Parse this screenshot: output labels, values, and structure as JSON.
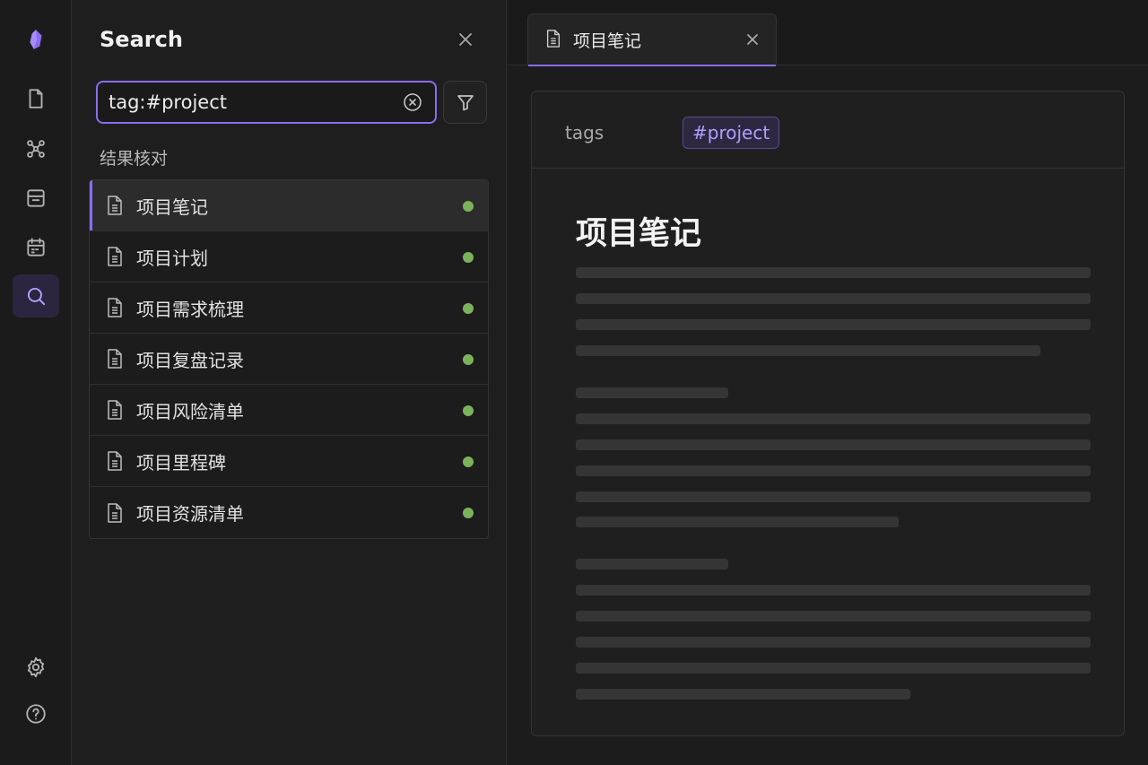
{
  "ribbon": {
    "items": [
      {
        "name": "app-logo-icon"
      },
      {
        "name": "files-icon"
      },
      {
        "name": "graph-icon"
      },
      {
        "name": "archive-icon"
      },
      {
        "name": "calendar-icon"
      },
      {
        "name": "search-icon",
        "active": true
      },
      {
        "name": "settings-icon"
      },
      {
        "name": "help-icon"
      }
    ]
  },
  "search": {
    "title": "Search",
    "query": "tag:#project",
    "results_label": "结果核对",
    "results": [
      {
        "name": "项目笔记",
        "active": true
      },
      {
        "name": "项目计划"
      },
      {
        "name": "项目需求梳理"
      },
      {
        "name": "项目复盘记录"
      },
      {
        "name": "项目风险清单"
      },
      {
        "name": "项目里程碑"
      },
      {
        "name": "项目资源清单"
      }
    ]
  },
  "tab": {
    "title": "项目笔记"
  },
  "note": {
    "prop_key": "tags",
    "tag": "#project",
    "title": "项目笔记"
  },
  "colors": {
    "accent": "#8b6cf0",
    "status_dot": "#7cb35a",
    "tag_text": "#b39dff"
  }
}
